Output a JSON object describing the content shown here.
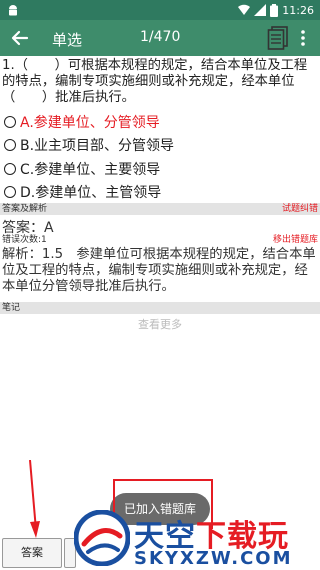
{
  "status_bar": {
    "time": "11:26"
  },
  "toolbar": {
    "title": "单选",
    "counter": "1/470"
  },
  "question": {
    "text": "1.（　　）可根据本规程的规定，结合本单位及工程的特点，编制专项实施细则或补充规定，经本单位（　　）批准后执行。"
  },
  "options": [
    {
      "label": "A.参建单位、分管领导",
      "selected": true
    },
    {
      "label": "B.业主项目部、分管领导",
      "selected": false
    },
    {
      "label": "C.参建单位、主要领导",
      "selected": false
    },
    {
      "label": "D.参建单位、主管领导",
      "selected": false
    }
  ],
  "answer_section": {
    "header": "答案及解析",
    "report_link": "试题纠错",
    "answer": "答案：A"
  },
  "error_section": {
    "count": "错误次数:1",
    "remove_link": "移出错题库"
  },
  "analysis": "解析：1.5　参建单位可根据本规程的规定，结合本单位及工程的特点，编制专项实施细则或补充规定，经本单位分管领导批准后执行。",
  "notes": {
    "header": "笔记",
    "more": "查看更多"
  },
  "toast": {
    "text": "已加入错题库"
  },
  "bottom": {
    "answer_button": "答案"
  },
  "watermark": {
    "title_a": "天空",
    "title_b": "下载玩",
    "url": "SKYXZW.COM"
  },
  "colors": {
    "toolbar": "#3e8c6b",
    "accent_red": "#e51c23",
    "watermark_blue": "#1a4fa0"
  }
}
